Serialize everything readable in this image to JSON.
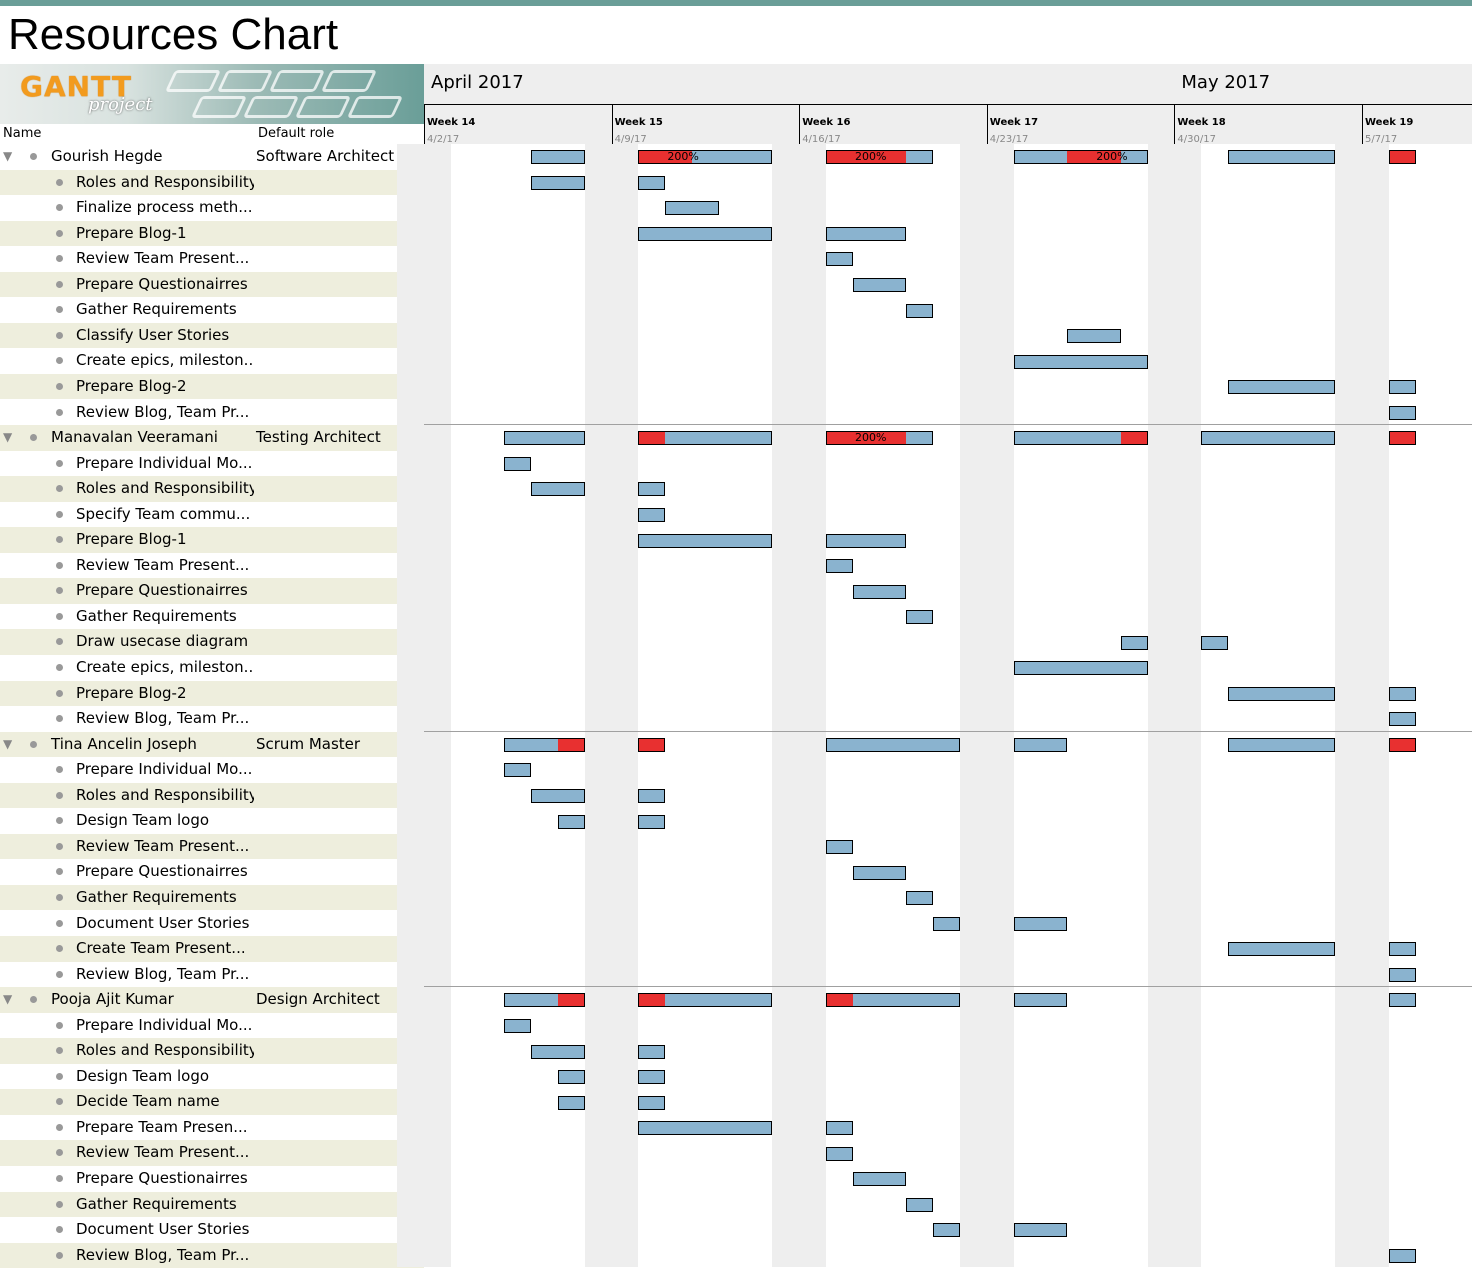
{
  "page": {
    "title": "Resources Chart"
  },
  "logo": {
    "word1": "GANTT",
    "word2": "project"
  },
  "table": {
    "col_name": "Name",
    "col_role": "Default role"
  },
  "timeline": {
    "months": [
      {
        "label": "April 2017",
        "week_index": 0
      },
      {
        "label": "May 2017",
        "week_index": 4
      }
    ],
    "weeks": [
      {
        "label": "Week 14",
        "date": "4/2/17"
      },
      {
        "label": "Week 15",
        "date": "4/9/17"
      },
      {
        "label": "Week 16",
        "date": "4/16/17"
      },
      {
        "label": "Week 17",
        "date": "4/23/17"
      },
      {
        "label": "Week 18",
        "date": "4/30/17"
      },
      {
        "label": "Week 19",
        "date": "5/7/17"
      }
    ]
  },
  "colors": {
    "bar": "#8ab3cf",
    "overload": "#e83030",
    "stripe": "#eeeedd",
    "weekend": "#eeeeee"
  },
  "resources": [
    {
      "name": "Gourish Hegde",
      "role": "Software Architect",
      "bars": [
        {
          "from": 4,
          "to": 6
        },
        {
          "from": 8,
          "to": 13,
          "over": [
            8,
            10
          ],
          "label": "200%"
        },
        {
          "from": 15,
          "to": 19,
          "over": [
            15,
            18
          ],
          "label": "200%"
        },
        {
          "from": 22,
          "to": 27,
          "over": [
            24,
            26
          ],
          "label": "200%"
        },
        {
          "from": 30,
          "to": 34
        },
        {
          "from": 36,
          "to": 37,
          "over": [
            36,
            37
          ]
        }
      ],
      "tasks": [
        {
          "name": "Roles and Responsibility",
          "bars": [
            {
              "from": 4,
              "to": 6
            },
            {
              "from": 8,
              "to": 9
            }
          ]
        },
        {
          "name": "Finalize process meth...",
          "bars": [
            {
              "from": 9,
              "to": 11
            }
          ]
        },
        {
          "name": "Prepare Blog-1",
          "bars": [
            {
              "from": 8,
              "to": 13
            },
            {
              "from": 15,
              "to": 18
            }
          ]
        },
        {
          "name": "Review Team Present...",
          "bars": [
            {
              "from": 15,
              "to": 16
            }
          ]
        },
        {
          "name": "Prepare Questionairres",
          "bars": [
            {
              "from": 16,
              "to": 18
            }
          ]
        },
        {
          "name": "Gather Requirements",
          "bars": [
            {
              "from": 18,
              "to": 19
            }
          ]
        },
        {
          "name": "Classify User Stories",
          "bars": [
            {
              "from": 24,
              "to": 26
            }
          ]
        },
        {
          "name": "Create epics, mileston...",
          "bars": [
            {
              "from": 22,
              "to": 27
            }
          ]
        },
        {
          "name": "Prepare Blog-2",
          "bars": [
            {
              "from": 30,
              "to": 34
            },
            {
              "from": 36,
              "to": 37
            }
          ]
        },
        {
          "name": "Review Blog, Team Pr...",
          "bars": [
            {
              "from": 36,
              "to": 37
            }
          ]
        }
      ]
    },
    {
      "name": "Manavalan Veeramani",
      "role": "Testing Architect",
      "bars": [
        {
          "from": 3,
          "to": 6
        },
        {
          "from": 8,
          "to": 13,
          "over": [
            8,
            9
          ]
        },
        {
          "from": 15,
          "to": 19,
          "over": [
            15,
            18
          ],
          "label": "200%"
        },
        {
          "from": 22,
          "to": 27,
          "over": [
            26,
            27
          ]
        },
        {
          "from": 29,
          "to": 34
        },
        {
          "from": 36,
          "to": 37,
          "over": [
            36,
            37
          ]
        }
      ],
      "tasks": [
        {
          "name": "Prepare Individual Mo...",
          "bars": [
            {
              "from": 3,
              "to": 4
            }
          ]
        },
        {
          "name": "Roles and Responsibility",
          "bars": [
            {
              "from": 4,
              "to": 6
            },
            {
              "from": 8,
              "to": 9
            }
          ]
        },
        {
          "name": "Specify Team commu...",
          "bars": [
            {
              "from": 8,
              "to": 9
            }
          ]
        },
        {
          "name": "Prepare Blog-1",
          "bars": [
            {
              "from": 8,
              "to": 13
            },
            {
              "from": 15,
              "to": 18
            }
          ]
        },
        {
          "name": "Review Team Present...",
          "bars": [
            {
              "from": 15,
              "to": 16
            }
          ]
        },
        {
          "name": "Prepare Questionairres",
          "bars": [
            {
              "from": 16,
              "to": 18
            }
          ]
        },
        {
          "name": "Gather Requirements",
          "bars": [
            {
              "from": 18,
              "to": 19
            }
          ]
        },
        {
          "name": "Draw usecase diagram",
          "bars": [
            {
              "from": 26,
              "to": 27
            },
            {
              "from": 29,
              "to": 30
            }
          ]
        },
        {
          "name": "Create epics, mileston...",
          "bars": [
            {
              "from": 22,
              "to": 27
            }
          ]
        },
        {
          "name": "Prepare Blog-2",
          "bars": [
            {
              "from": 30,
              "to": 34
            },
            {
              "from": 36,
              "to": 37
            }
          ]
        },
        {
          "name": "Review Blog, Team Pr...",
          "bars": [
            {
              "from": 36,
              "to": 37
            }
          ]
        }
      ]
    },
    {
      "name": "Tina Ancelin Joseph",
      "role": "Scrum Master",
      "bars": [
        {
          "from": 3,
          "to": 6,
          "over": [
            5,
            6
          ]
        },
        {
          "from": 8,
          "to": 9,
          "over": [
            8,
            9
          ]
        },
        {
          "from": 15,
          "to": 20
        },
        {
          "from": 22,
          "to": 24
        },
        {
          "from": 30,
          "to": 34
        },
        {
          "from": 36,
          "to": 37,
          "over": [
            36,
            37
          ]
        }
      ],
      "tasks": [
        {
          "name": "Prepare Individual Mo...",
          "bars": [
            {
              "from": 3,
              "to": 4
            }
          ]
        },
        {
          "name": "Roles and Responsibility",
          "bars": [
            {
              "from": 4,
              "to": 6
            },
            {
              "from": 8,
              "to": 9
            }
          ]
        },
        {
          "name": "Design Team logo",
          "bars": [
            {
              "from": 5,
              "to": 6
            },
            {
              "from": 8,
              "to": 9
            }
          ]
        },
        {
          "name": "Review Team Present...",
          "bars": [
            {
              "from": 15,
              "to": 16
            }
          ]
        },
        {
          "name": "Prepare Questionairres",
          "bars": [
            {
              "from": 16,
              "to": 18
            }
          ]
        },
        {
          "name": "Gather Requirements",
          "bars": [
            {
              "from": 18,
              "to": 19
            }
          ]
        },
        {
          "name": "Document User Stories",
          "bars": [
            {
              "from": 19,
              "to": 20
            },
            {
              "from": 22,
              "to": 24
            }
          ]
        },
        {
          "name": "Create Team Present...",
          "bars": [
            {
              "from": 30,
              "to": 34
            },
            {
              "from": 36,
              "to": 37
            }
          ]
        },
        {
          "name": "Review Blog, Team Pr...",
          "bars": [
            {
              "from": 36,
              "to": 37
            }
          ]
        }
      ]
    },
    {
      "name": "Pooja Ajit Kumar",
      "role": "Design Architect",
      "bars": [
        {
          "from": 3,
          "to": 6,
          "over": [
            5,
            6
          ]
        },
        {
          "from": 8,
          "to": 13,
          "over": [
            8,
            9
          ]
        },
        {
          "from": 15,
          "to": 20,
          "over": [
            15,
            16
          ]
        },
        {
          "from": 22,
          "to": 24
        },
        {
          "from": 36,
          "to": 37
        }
      ],
      "tasks": [
        {
          "name": "Prepare Individual Mo...",
          "bars": [
            {
              "from": 3,
              "to": 4
            }
          ]
        },
        {
          "name": "Roles and Responsibility",
          "bars": [
            {
              "from": 4,
              "to": 6
            },
            {
              "from": 8,
              "to": 9
            }
          ]
        },
        {
          "name": "Design Team logo",
          "bars": [
            {
              "from": 5,
              "to": 6
            },
            {
              "from": 8,
              "to": 9
            }
          ]
        },
        {
          "name": "Decide Team name",
          "bars": [
            {
              "from": 5,
              "to": 6
            },
            {
              "from": 8,
              "to": 9
            }
          ]
        },
        {
          "name": "Prepare Team Presen...",
          "bars": [
            {
              "from": 8,
              "to": 13
            },
            {
              "from": 15,
              "to": 16
            }
          ]
        },
        {
          "name": "Review Team Present...",
          "bars": [
            {
              "from": 15,
              "to": 16
            }
          ]
        },
        {
          "name": "Prepare Questionairres",
          "bars": [
            {
              "from": 16,
              "to": 18
            }
          ]
        },
        {
          "name": "Gather Requirements",
          "bars": [
            {
              "from": 18,
              "to": 19
            }
          ]
        },
        {
          "name": "Document User Stories",
          "bars": [
            {
              "from": 19,
              "to": 20
            },
            {
              "from": 22,
              "to": 24
            }
          ]
        },
        {
          "name": "Review Blog, Team Pr...",
          "bars": [
            {
              "from": 36,
              "to": 37
            }
          ]
        }
      ]
    }
  ]
}
